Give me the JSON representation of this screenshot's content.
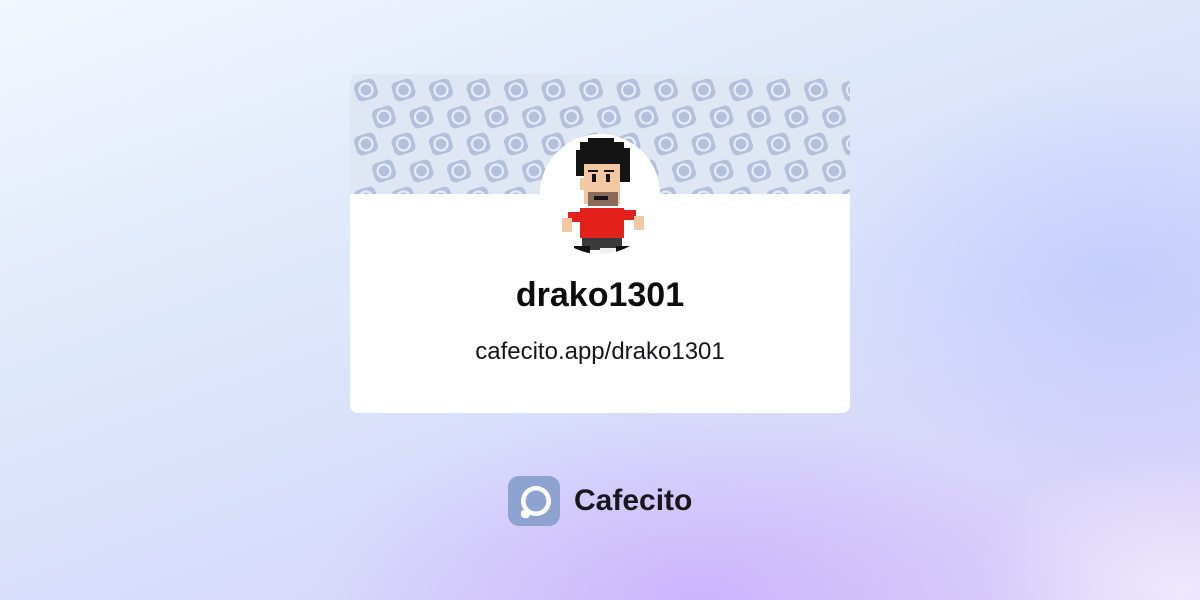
{
  "profile": {
    "username": "drako1301",
    "link": "cafecito.app/drako1301"
  },
  "brand": {
    "name": "Cafecito"
  },
  "icons": {
    "banner_pattern": "coffee-cup-icon",
    "logo": "cafecito-logo-icon"
  },
  "colors": {
    "banner_background": "#dfe6f4",
    "banner_icon": "#b4c0dc",
    "logo": "#8ea3cf",
    "avatar_shirt": "#e3201b"
  }
}
